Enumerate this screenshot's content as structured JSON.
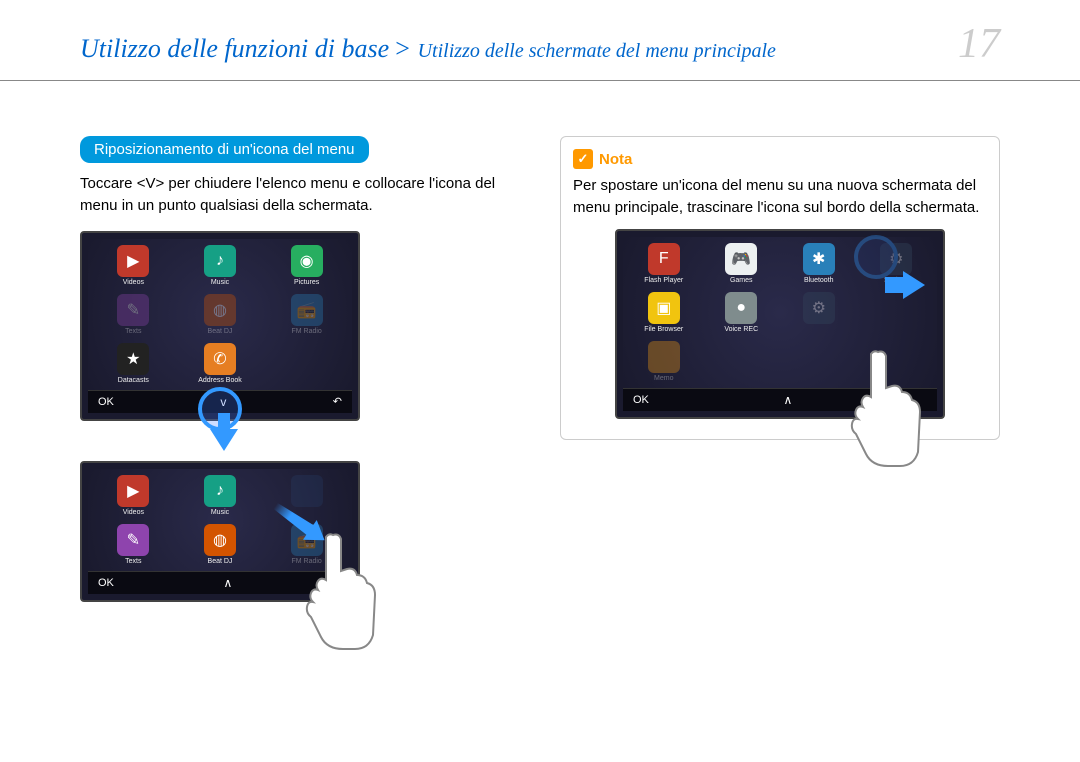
{
  "header": {
    "breadcrumb_main": "Utilizzo delle funzioni di base",
    "breadcrumb_separator": " > ",
    "breadcrumb_sub": "Utilizzo delle schermate del menu principale",
    "page_number": "17"
  },
  "left": {
    "section_heading": "Riposizionamento di un'icona del menu",
    "body_text": "Toccare <V> per chiudere l'elenco menu e collocare l'icona del menu in un punto qualsiasi della schermata.",
    "screen1": {
      "icons": [
        {
          "name": "videos-icon",
          "label": "Videos",
          "glyph": "▶"
        },
        {
          "name": "music-icon",
          "label": "Music",
          "glyph": "♪"
        },
        {
          "name": "pictures-icon",
          "label": "Pictures",
          "glyph": "◉"
        },
        {
          "name": "texts-icon",
          "label": "Texts",
          "glyph": "✎"
        },
        {
          "name": "beatdj-icon",
          "label": "Beat DJ",
          "glyph": "◍"
        },
        {
          "name": "fmradio-icon",
          "label": "FM Radio",
          "glyph": "📻"
        },
        {
          "name": "datacasts-icon",
          "label": "Datacasts",
          "glyph": "★"
        },
        {
          "name": "addressbook-icon",
          "label": "Address Book",
          "glyph": "✆"
        }
      ],
      "ok": "OK",
      "mid": "v",
      "right": "↶"
    },
    "screen2": {
      "icons": [
        {
          "name": "videos-icon",
          "label": "Videos",
          "glyph": "▶"
        },
        {
          "name": "music-icon",
          "label": "Music",
          "glyph": "♪"
        },
        {
          "name": "placeholder-icon",
          "label": "",
          "glyph": ""
        },
        {
          "name": "texts-icon",
          "label": "Texts",
          "glyph": "✎"
        },
        {
          "name": "beatdj-icon",
          "label": "Beat DJ",
          "glyph": "◍"
        },
        {
          "name": "fmradio-icon",
          "label": "FM Radio",
          "glyph": "📻"
        }
      ],
      "ok": "OK",
      "mid": "∧",
      "right": ""
    }
  },
  "right": {
    "note_label": "Nota",
    "note_text": "Per spostare un'icona del menu su una nuova schermata del menu principale, trascinare l'icona sul bordo della schermata.",
    "screen": {
      "icons": [
        {
          "name": "flashplayer-icon",
          "label": "Flash Player",
          "glyph": "F"
        },
        {
          "name": "games-icon",
          "label": "Games",
          "glyph": "🎮"
        },
        {
          "name": "bluetooth-icon",
          "label": "Bluetooth",
          "glyph": "✱"
        },
        {
          "name": "filebrowser-icon",
          "label": "File Browser",
          "glyph": "▣"
        },
        {
          "name": "voicerec-icon",
          "label": "Voice REC",
          "glyph": "●"
        },
        {
          "name": "settings-icon",
          "label": "Settings",
          "glyph": "⚙"
        },
        {
          "name": "memo-icon",
          "label": "Memo",
          "glyph": ""
        }
      ],
      "ok": "OK",
      "mid": "∧",
      "right": ""
    }
  }
}
